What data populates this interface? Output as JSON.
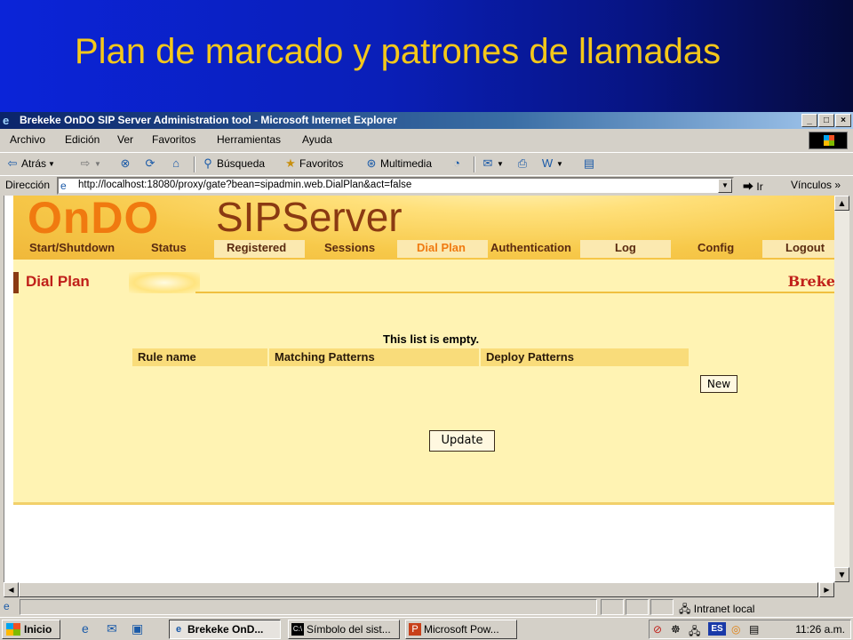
{
  "slide": {
    "title": "Plan de marcado y patrones de llamadas"
  },
  "window": {
    "title": "Brekeke OnDO SIP Server Administration tool - Microsoft Internet Explorer",
    "buttons": {
      "minimize": "_",
      "maximize": "□",
      "close": "×"
    }
  },
  "menu": {
    "items": [
      "Archivo",
      "Edición",
      "Ver",
      "Favoritos",
      "Herramientas",
      "Ayuda"
    ]
  },
  "toolbar": {
    "back": "Atrás",
    "search": "Búsqueda",
    "favorites": "Favoritos",
    "media": "Multimedia"
  },
  "address": {
    "label": "Dirección",
    "url": "http://localhost:18080/proxy/gate?bean=sipadmin.web.DialPlan&act=false",
    "go": "Ir",
    "links": "Vínculos"
  },
  "page": {
    "logo_left": "OnDO",
    "logo_right": "SIPServer",
    "nav": [
      {
        "label": "Start/Shutdown",
        "active": false
      },
      {
        "label": "Status",
        "active": false
      },
      {
        "label": "Registered",
        "active": false
      },
      {
        "label": "Sessions",
        "active": false
      },
      {
        "label": "Dial Plan",
        "active": true
      },
      {
        "label": "Authentication",
        "active": false
      },
      {
        "label": "Log",
        "active": false
      },
      {
        "label": "Config",
        "active": false
      },
      {
        "label": "Logout",
        "active": false
      }
    ],
    "section_title": "Dial Plan",
    "brand": "Breke",
    "empty_message": "This list is empty.",
    "columns": [
      "Rule name",
      "Matching Patterns",
      "Deploy Patterns"
    ],
    "new_button": "New",
    "update_button": "Update"
  },
  "status": {
    "zone": "Intranet local"
  },
  "taskbar": {
    "start": "Inicio",
    "tasks": [
      {
        "label": "Brekeke OnD...",
        "active": true
      },
      {
        "label": "Símbolo del sist...",
        "active": false
      },
      {
        "label": "Microsoft Pow...",
        "active": false
      }
    ],
    "language": "ES",
    "clock": "11:26 a.m."
  },
  "colors": {
    "slide_title": "#f4c81a",
    "logo_orange": "#f07a10",
    "logo_brown": "#8a3a12",
    "content_bg": "#fff3b3",
    "section_title": "#c0201a"
  }
}
